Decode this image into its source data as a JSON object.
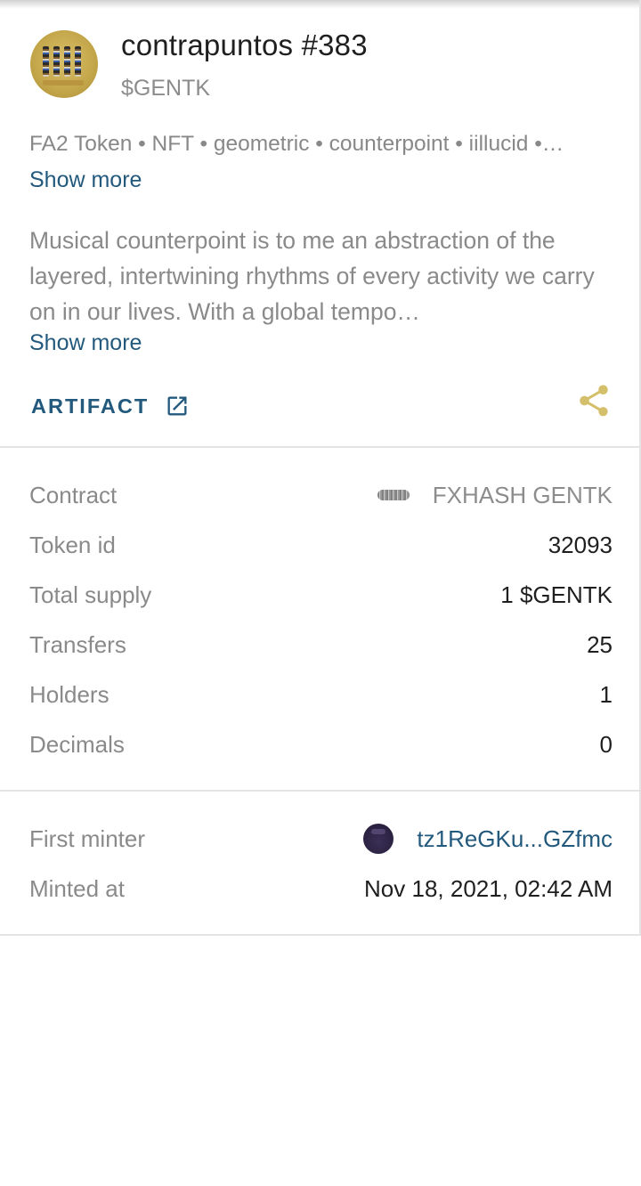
{
  "token": {
    "title": "contrapuntos #383",
    "symbol": "$GENTK",
    "tags": "FA2 Token • NFT • geometric • counterpoint • iillucid •…",
    "tags_show_more": "Show more",
    "description": "Musical counterpoint is to me an abstraction of the layered, intertwining rhythms of every activity we carry on in our lives. With a global tempo…",
    "description_show_more": "Show more",
    "artifact_label": "ARTIFACT",
    "icons": {
      "thumbnail": "token-thumbnail",
      "artifact": "open-in-new-icon",
      "share": "share-icon",
      "contract_logo": "fxhash-logo-icon",
      "minter_avatar": "minter-avatar"
    }
  },
  "details": {
    "contract": {
      "label": "Contract",
      "value": "FXHASH GENTK"
    },
    "token_id": {
      "label": "Token id",
      "value": "32093"
    },
    "total_supply": {
      "label": "Total supply",
      "value": "1 $GENTK"
    },
    "transfers": {
      "label": "Transfers",
      "value": "25"
    },
    "holders": {
      "label": "Holders",
      "value": "1"
    },
    "decimals": {
      "label": "Decimals",
      "value": "0"
    }
  },
  "mint": {
    "first_minter": {
      "label": "First minter",
      "value": "tz1ReGKu...GZfmc"
    },
    "minted_at": {
      "label": "Minted at",
      "value": "Nov 18, 2021, 02:42 AM"
    }
  },
  "colors": {
    "link": "#23597d",
    "share_accent": "#d4bf6a",
    "muted_text": "#8a8a8a",
    "divider": "#e4e4e4"
  }
}
